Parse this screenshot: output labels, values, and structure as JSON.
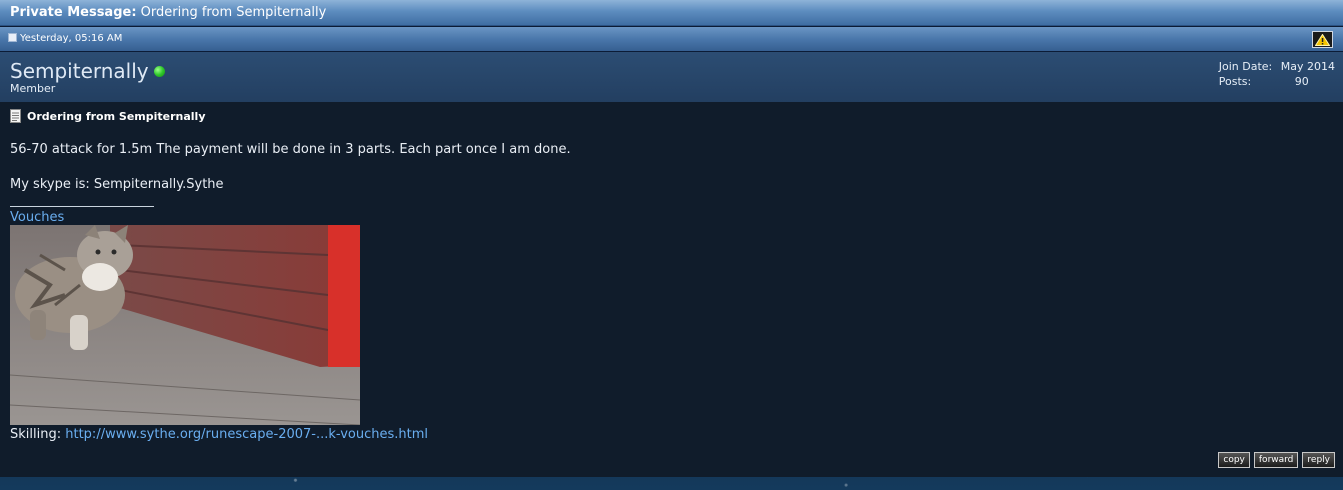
{
  "header": {
    "label": "Private Message:",
    "subject": "Ordering from Sempiternally"
  },
  "datebar": {
    "timestamp": "Yesterday, 05:16 AM",
    "report_icon": "warning-icon"
  },
  "user": {
    "name": "Sempiternally",
    "status": "online",
    "title": "Member",
    "join_label": "Join Date:",
    "join_value": "May 2014",
    "posts_label": "Posts:",
    "posts_value": "90"
  },
  "message": {
    "title": "Ordering from Sempiternally",
    "line1": "56-70 attack for 1.5m The payment will be done in 3 parts. Each part once I am done.",
    "line2": "My skype is: Sempiternally.Sythe"
  },
  "signature": {
    "vouches_link": "Vouches",
    "skilling_label": "Skilling:",
    "skilling_link": "http://www.sythe.org/runescape-2007-...k-vouches.html"
  },
  "actions": {
    "copy": "copy",
    "forward": "forward",
    "reply": "reply"
  },
  "colors": {
    "link": "#6aaef0",
    "online": "#2fc92a",
    "titlebar": "#5d8cbf"
  }
}
